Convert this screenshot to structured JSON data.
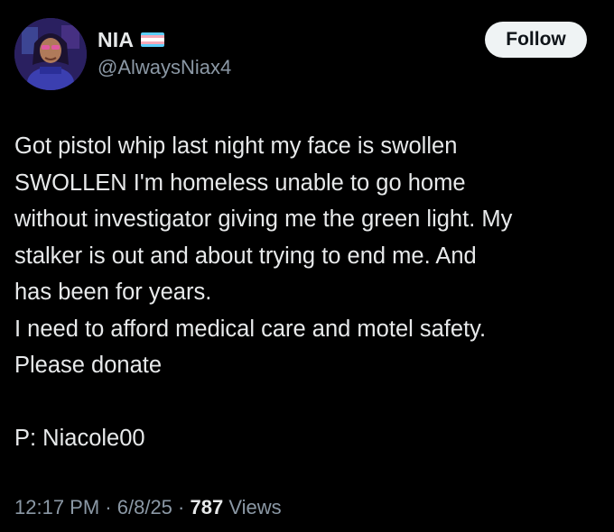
{
  "author": {
    "display_name": "NIA",
    "handle": "@AlwaysNiax4",
    "flag_icon": "transgender-flag",
    "flag_colors": [
      "#5bcefa",
      "#f5a9b8",
      "#ffffff",
      "#f5a9b8",
      "#5bcefa"
    ]
  },
  "follow_button": {
    "label": "Follow"
  },
  "tweet": {
    "lines": [
      "Got pistol whip last night my face is swollen",
      "SWOLLEN I'm homeless unable to go home",
      "without investigator giving me the green light. My",
      "stalker is out and about trying to end me. And",
      "has been for years.",
      "I need to afford medical care and motel safety.",
      "Please donate",
      "",
      "P: Niacole00"
    ]
  },
  "meta": {
    "time": "12:17 PM",
    "separator": "·",
    "date": "6/8/25",
    "views_count": "787",
    "views_label": "Views"
  },
  "colors": {
    "background": "#000000",
    "text_primary": "#e7e9ea",
    "text_secondary": "#8b98a5",
    "button_bg": "#eff3f4",
    "button_text": "#0f1419"
  }
}
